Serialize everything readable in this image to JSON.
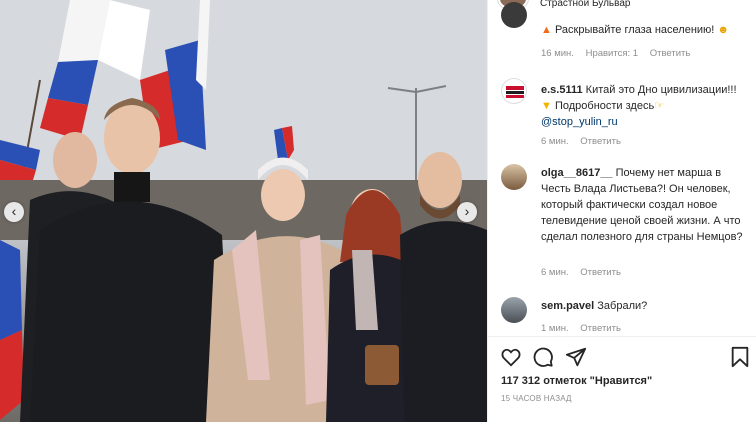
{
  "post": {
    "author": "Страстной Бульвар",
    "likes_text": "117 312 отметок \"Нравится\"",
    "time_ago": "15 ЧАСОВ НАЗАД"
  },
  "photo": {
    "prev_label": "‹",
    "next_label": "›"
  },
  "comments": [
    {
      "user": "",
      "text_prefix": "",
      "text": "Раскрывайте глаза населению! ",
      "meta": {
        "time": "16 мин.",
        "likes": "Нравится: 1",
        "reply": "Ответить"
      }
    },
    {
      "user": "e.s.5111",
      "text": "Китай это Дно цивилизации!!!",
      "line2": "Подробности здесь",
      "link": "@stop_yulin_ru",
      "meta": {
        "time": "6 мин.",
        "reply": "Ответить"
      }
    },
    {
      "user": "olga__8617__",
      "text": "Почему нет марша в Честь Влада Листьева?! Он человек, который фактически создал новое телевидение ценой своей жизни. А что сделал полезного для страны Немцов?",
      "meta": {
        "time": "6 мин.",
        "reply": "Ответить"
      }
    },
    {
      "user": "sem.pavel",
      "text": "Забрали?",
      "meta": {
        "time": "1 мин.",
        "reply": "Ответить"
      }
    }
  ],
  "icons": [
    "heart-icon",
    "comment-icon",
    "share-icon",
    "bookmark-icon",
    "chevron-left-icon",
    "chevron-right-icon"
  ],
  "colors": {
    "link": "#00376b",
    "meta": "#8e8e8e",
    "text": "#262626"
  }
}
